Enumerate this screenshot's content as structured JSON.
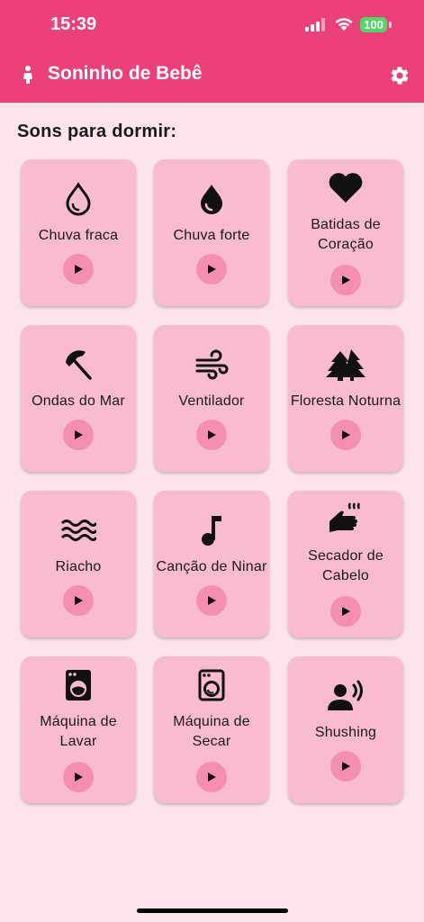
{
  "status_bar": {
    "time": "15:39",
    "battery": "100"
  },
  "header": {
    "title": "Soninho de Bebê"
  },
  "section": {
    "title": "Sons para dormir:"
  },
  "sounds": [
    {
      "label": "Chuva fraca",
      "icon": "droplet-outline-icon"
    },
    {
      "label": "Chuva forte",
      "icon": "droplet-filled-icon"
    },
    {
      "label": "Batidas de\nCoração",
      "icon": "heart-icon"
    },
    {
      "label": "Ondas do Mar",
      "icon": "beach-umbrella-icon"
    },
    {
      "label": "Ventilador",
      "icon": "wind-icon"
    },
    {
      "label": "Floresta Noturna",
      "icon": "forest-icon"
    },
    {
      "label": "Riacho",
      "icon": "waves-icon"
    },
    {
      "label": "Canção de Ninar",
      "icon": "music-note-icon"
    },
    {
      "label": "Secador de\nCabelo",
      "icon": "hand-dryer-icon"
    },
    {
      "label": "Máquina de\nLavar",
      "icon": "washing-machine-icon"
    },
    {
      "label": "Máquina de\nSecar",
      "icon": "dryer-icon"
    },
    {
      "label": "Shushing",
      "icon": "person-voice-icon"
    }
  ],
  "colors": {
    "app_bar": "#ec407a",
    "background": "#fce4ec",
    "card": "#f8bbd0",
    "play_button": "#f48fb1"
  }
}
